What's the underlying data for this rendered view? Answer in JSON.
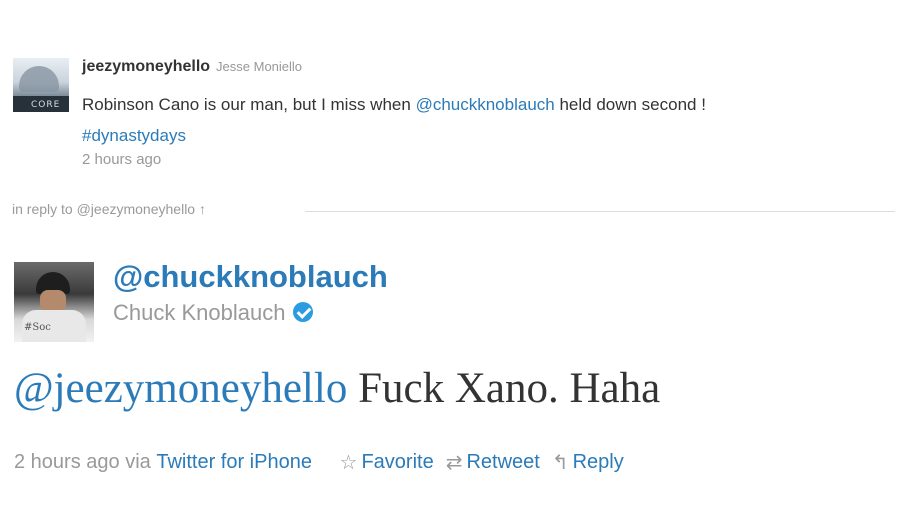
{
  "original_tweet": {
    "username": "jeezymoneyhello",
    "full_name": "Jesse Moniello",
    "avatar_caption": "CORE",
    "text_before": "Robinson Cano is our man, but I miss when ",
    "mention": "@chuckknoblauch",
    "text_after": " held down second !",
    "hashtag": "#dynastydays",
    "time": "2 hours ago"
  },
  "in_reply_to": {
    "prefix": "in reply to ",
    "handle": "@jeezymoneyhello",
    "arrow_icon": "↑"
  },
  "tweet": {
    "username": "@chuckknoblauch",
    "full_name": "Chuck Knoblauch",
    "verified": true,
    "avatar_caption": "#Soc",
    "mention": "@jeezymoneyhello",
    "text": " Fuck Xano. Haha",
    "time": "2 hours ago",
    "via_prefix": " via ",
    "via_source": "Twitter for iPhone"
  },
  "actions": {
    "favorite_icon": "☆",
    "favorite_label": "Favorite",
    "retweet_icon": "⇄",
    "retweet_label": "Retweet",
    "reply_icon": "↰",
    "reply_label": "Reply"
  },
  "colors": {
    "link": "#2b7bb9",
    "muted": "#999999",
    "text": "#333333",
    "verified": "#2b9ce0"
  }
}
